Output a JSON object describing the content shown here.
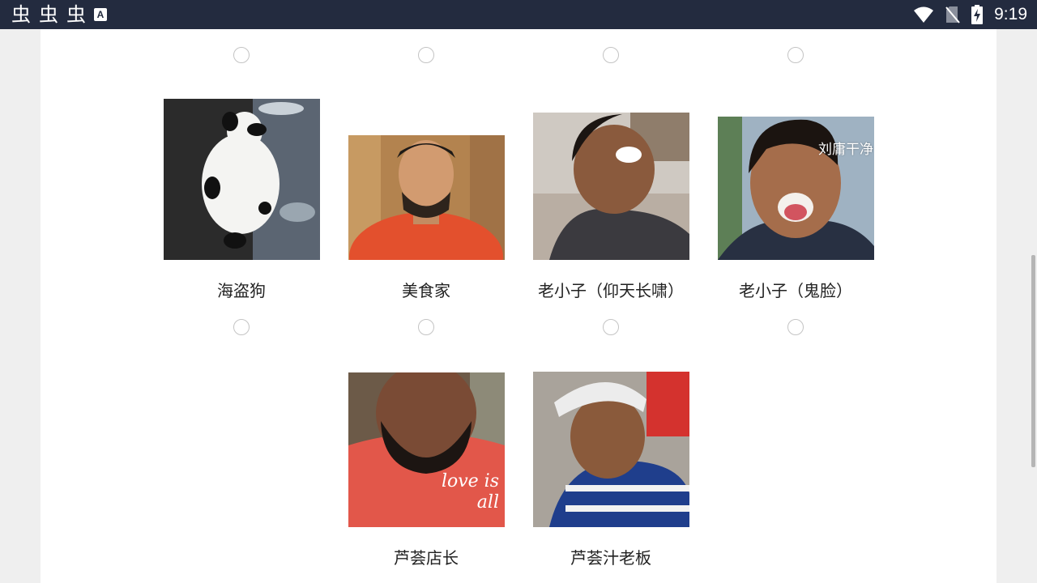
{
  "status_bar": {
    "left_icons": [
      "虫",
      "虫",
      "虫"
    ],
    "a_badge": "A",
    "time": "9:19"
  },
  "grid": {
    "row2": [
      {
        "label": "海盗狗"
      },
      {
        "label": "美食家"
      },
      {
        "label": "老小子（仰天长啸）"
      },
      {
        "label": "老小子（鬼脸）",
        "overlay_text": "刘庸干净"
      }
    ],
    "row3": [
      {
        "label": "芦荟店长",
        "shirt_text": "love is all"
      },
      {
        "label": "芦荟汁老板"
      }
    ]
  }
}
